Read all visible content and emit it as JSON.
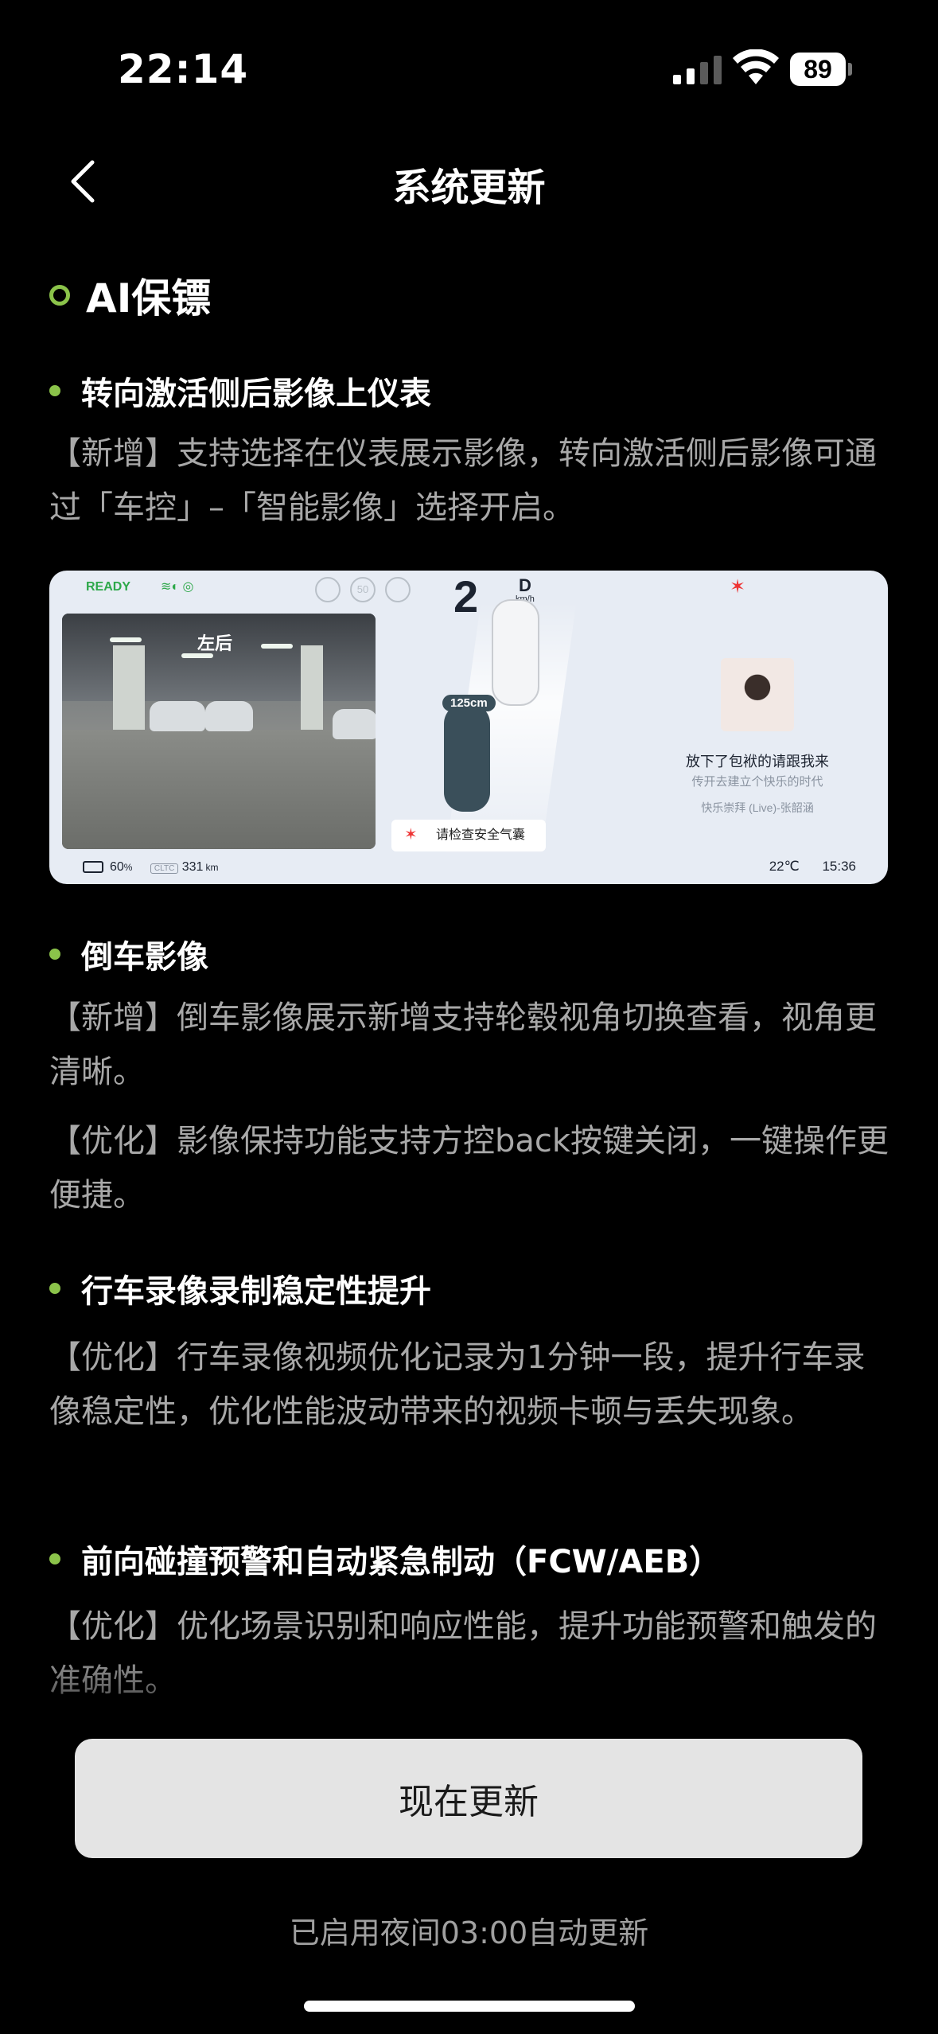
{
  "status_bar": {
    "time": "22:14",
    "battery": "89"
  },
  "header": {
    "title": "系统更新"
  },
  "section": {
    "title": "AI保镖"
  },
  "features": [
    {
      "title": "转向激活侧后影像上仪表",
      "paragraphs": [
        "【新增】支持选择在仪表展示影像，转向激活侧后影像可通过「车控」–「智能影像」选择开启。"
      ]
    },
    {
      "title": "倒车影像",
      "paragraphs": [
        "【新增】倒车影像展示新增支持轮毂视角切换查看，视角更清晰。",
        "【优化】影像保持功能支持方控back按键关闭，一键操作更便捷。"
      ]
    },
    {
      "title": "行车录像录制稳定性提升",
      "paragraphs": [
        "【优化】行车录像视频优化记录为1分钟一段，提升行车录像稳定性，优化性能波动带来的视频卡顿与丢失现象。"
      ]
    },
    {
      "title": "前向碰撞预警和自动紧急制动（FCW/AEB）",
      "paragraphs": [
        "【优化】优化场景识别和响应性能，提升功能预警和触发的准确性。"
      ]
    }
  ],
  "cluster": {
    "ready": "READY",
    "gear": "2",
    "drive_mode": "D",
    "speed_unit": "km/h",
    "speed_limits": [
      "",
      "50",
      ""
    ],
    "camera_label": "左后",
    "distance": "125cm",
    "warning": "请检查安全气囊",
    "song_title": "放下了包袱的请跟我来",
    "song_lyric": "传开去建立个快乐的时代",
    "song_artist": "快乐崇拜 (Live)-张韶涵",
    "battery": "60",
    "battery_unit": "%",
    "range_tag": "CLTC",
    "range": "331",
    "range_unit": "km",
    "temperature": "22℃",
    "clock": "15:36"
  },
  "actions": {
    "update_now": "现在更新"
  },
  "footer": {
    "auto_update_note": "已启用夜间03:00自动更新"
  },
  "colors": {
    "accent": "#8bc34a",
    "background": "#000000",
    "button": "#e4e4e4"
  }
}
